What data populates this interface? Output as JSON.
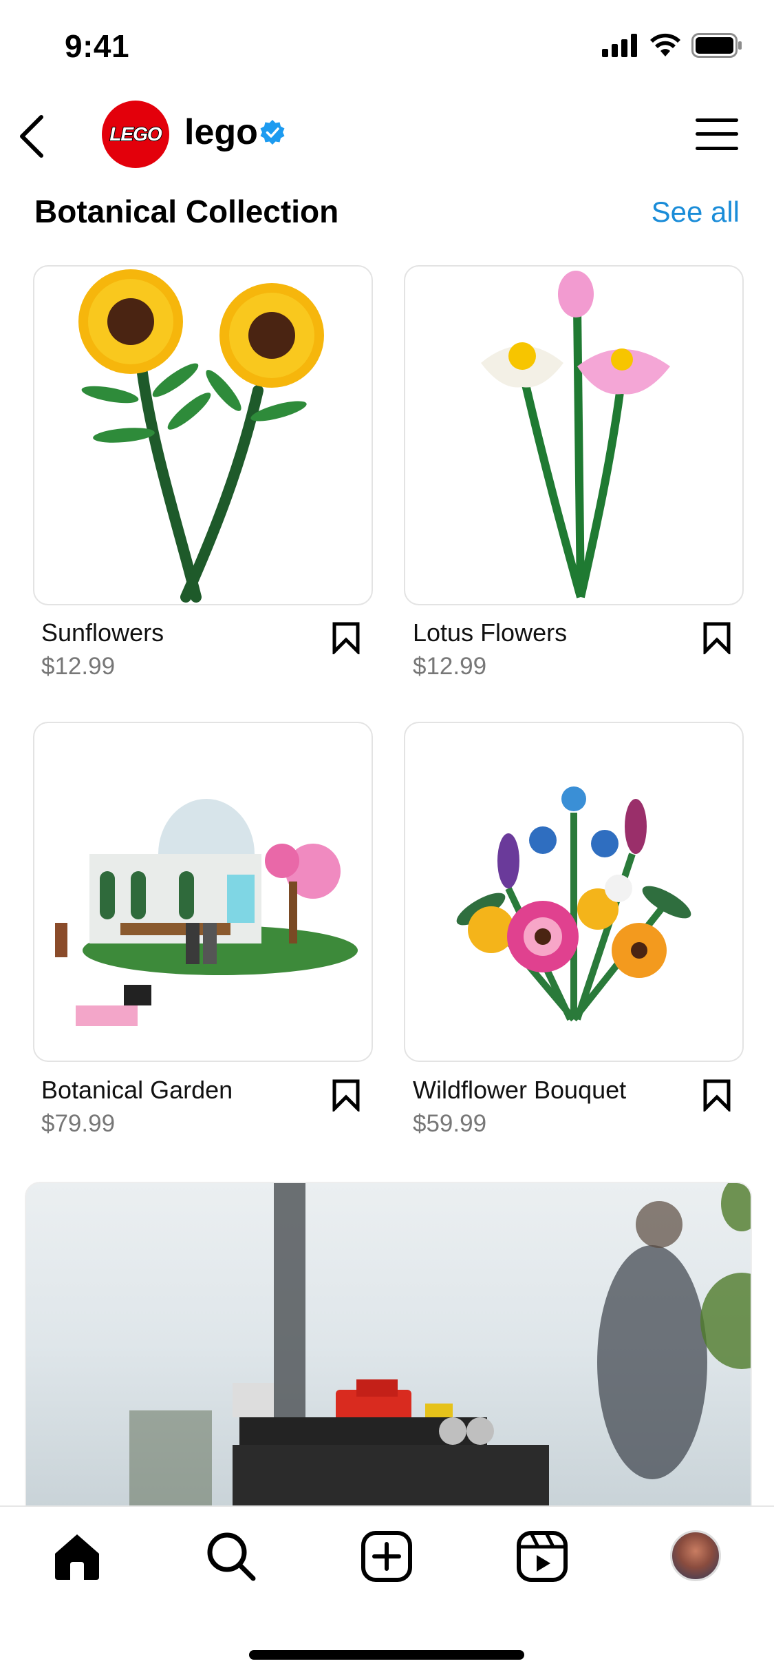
{
  "status_bar": {
    "time": "9:41"
  },
  "header": {
    "username": "lego",
    "logo_text": "LEGO"
  },
  "section": {
    "title": "Botanical Collection",
    "see_all": "See all"
  },
  "products": [
    {
      "name": "Sunflowers",
      "price": "$12.99"
    },
    {
      "name": "Lotus Flowers",
      "price": "$12.99"
    },
    {
      "name": "Botanical Garden",
      "price": "$79.99"
    },
    {
      "name": "Wildflower Bouquet",
      "price": "$59.99"
    }
  ],
  "icons": {
    "back": "chevron-left-icon",
    "verified": "verified-badge-icon",
    "menu": "hamburger-menu-icon",
    "bookmark": "bookmark-icon",
    "tabs": [
      "home-icon",
      "search-icon",
      "add-post-icon",
      "reels-icon",
      "profile-avatar"
    ]
  },
  "colors": {
    "accent": "#1a8cd8",
    "lego_red": "#e3000b",
    "verified": "#1d9bf0"
  }
}
